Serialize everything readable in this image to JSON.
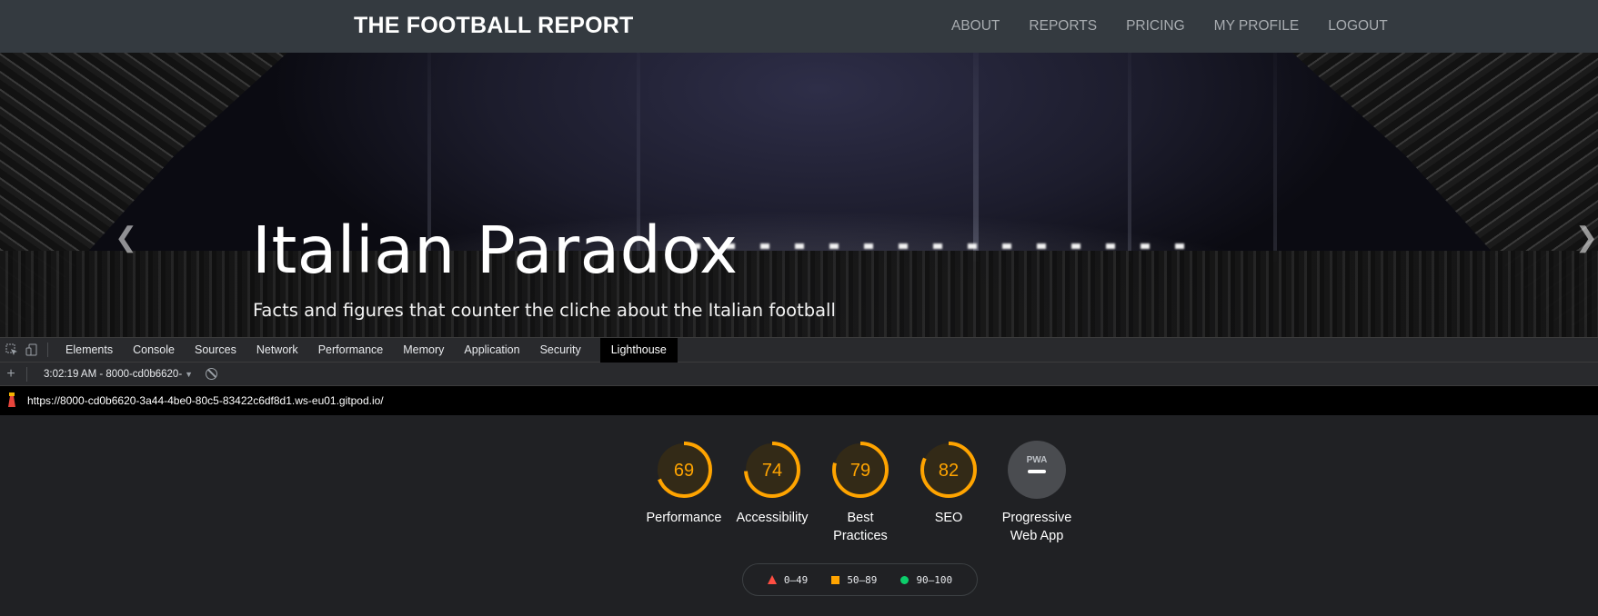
{
  "site": {
    "brand": "THE FOOTBALL REPORT",
    "nav": [
      "ABOUT",
      "REPORTS",
      "PRICING",
      "MY PROFILE",
      "LOGOUT"
    ]
  },
  "hero": {
    "title": "Italian Paradox",
    "subtitle": "Facts and figures that counter the cliche about the Italian football",
    "prev_icon": "chevron-left-icon",
    "next_icon": "chevron-right-icon"
  },
  "devtools": {
    "tabs": [
      "Elements",
      "Console",
      "Sources",
      "Network",
      "Performance",
      "Memory",
      "Application",
      "Security",
      "Lighthouse"
    ],
    "active_tab": "Lighthouse",
    "icons": [
      "inspect-element-icon",
      "device-toggle-icon"
    ]
  },
  "lighthouse": {
    "report_select": "3:02:19 AM - 8000-cd0b6620-",
    "url": "https://8000-cd0b6620-3a44-4be0-80c5-83422c6df8d1.ws-eu01.gitpod.io/",
    "colors": {
      "average": "#ffa400",
      "fail": "#ff4e42",
      "pass": "#0cce6b",
      "pwa": "#5f6368"
    },
    "scores": [
      {
        "label": "Performance",
        "score": "69"
      },
      {
        "label": "Accessibility",
        "score": "74"
      },
      {
        "label": "Best Practices",
        "score": "79"
      },
      {
        "label": "SEO",
        "score": "82"
      }
    ],
    "pwa": {
      "label": "Progressive Web App",
      "badge": "PWA"
    },
    "legend": [
      {
        "shape": "triangle",
        "range": "0–49"
      },
      {
        "shape": "square",
        "range": "50–89"
      },
      {
        "shape": "circle",
        "range": "90–100"
      }
    ]
  }
}
